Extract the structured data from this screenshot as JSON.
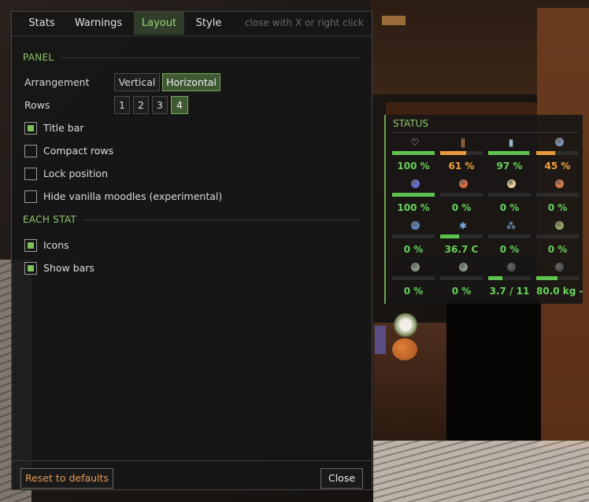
{
  "tabs": [
    {
      "label": "Stats",
      "active": false
    },
    {
      "label": "Warnings",
      "active": false
    },
    {
      "label": "Layout",
      "active": true
    },
    {
      "label": "Style",
      "active": false
    }
  ],
  "tab_hint": "close with X or right click",
  "panel_section": {
    "title": "PANEL",
    "arrangement_label": "Arrangement",
    "arrangement_options": [
      {
        "label": "Vertical",
        "selected": false
      },
      {
        "label": "Horizontal",
        "selected": true
      }
    ],
    "rows_label": "Rows",
    "rows_options": [
      {
        "label": "1",
        "selected": false
      },
      {
        "label": "2",
        "selected": false
      },
      {
        "label": "3",
        "selected": false
      },
      {
        "label": "4",
        "selected": true
      }
    ],
    "checkboxes": [
      {
        "label": "Title bar",
        "checked": true
      },
      {
        "label": "Compact rows",
        "checked": false
      },
      {
        "label": "Lock position",
        "checked": false
      },
      {
        "label": "Hide vanilla moodles (experimental)",
        "checked": false
      }
    ]
  },
  "each_stat_section": {
    "title": "EACH STAT",
    "checkboxes": [
      {
        "label": "Icons",
        "checked": true
      },
      {
        "label": "Show bars",
        "checked": true
      }
    ]
  },
  "footer": {
    "reset_label": "Reset to defaults",
    "close_label": "Close"
  },
  "status_widget": {
    "title": "STATUS",
    "colors": {
      "green": "#5fc24f",
      "orange": "#e89a3c",
      "text_green": "#66d35a",
      "text_orange": "#f0a040"
    },
    "stats": [
      {
        "icon": "heart-icon",
        "value": "100 %",
        "level": 1.0,
        "tone": "green"
      },
      {
        "icon": "fork-knife-icon",
        "value": "61 %",
        "level": 0.61,
        "tone": "orange"
      },
      {
        "icon": "water-bottle-icon",
        "value": "97 %",
        "level": 0.97,
        "tone": "green"
      },
      {
        "icon": "tired-face-icon",
        "value": "45 %",
        "level": 0.45,
        "tone": "orange"
      },
      {
        "icon": "sick-face-icon",
        "value": "100 %",
        "level": 1.0,
        "tone": "green"
      },
      {
        "icon": "angry-face-icon",
        "value": "0 %",
        "level": 0.0,
        "tone": "green"
      },
      {
        "icon": "scared-face-icon",
        "value": "0 %",
        "level": 0.0,
        "tone": "green"
      },
      {
        "icon": "bored-face-icon",
        "value": "0 %",
        "level": 0.0,
        "tone": "green"
      },
      {
        "icon": "sad-face-icon",
        "value": "0 %",
        "level": 0.0,
        "tone": "green"
      },
      {
        "icon": "snowflake-icon",
        "value": "36.7 C",
        "level": 0.45,
        "tone": "green"
      },
      {
        "icon": "wet-drops-icon",
        "value": "0 %",
        "level": 0.0,
        "tone": "green"
      },
      {
        "icon": "nauseous-face-icon",
        "value": "0 %",
        "level": 0.0,
        "tone": "green"
      },
      {
        "icon": "zombie-face-icon",
        "value": "0 %",
        "level": 0.0,
        "tone": "green"
      },
      {
        "icon": "stressed-face-icon",
        "value": "0 %",
        "level": 0.0,
        "tone": "green"
      },
      {
        "icon": "weight-icon",
        "value": "3.7 / 11",
        "level": 0.33,
        "tone": "green"
      },
      {
        "icon": "body-weight-icon",
        "value": "80.0 kg  -",
        "level": 0.5,
        "tone": "green"
      }
    ]
  }
}
